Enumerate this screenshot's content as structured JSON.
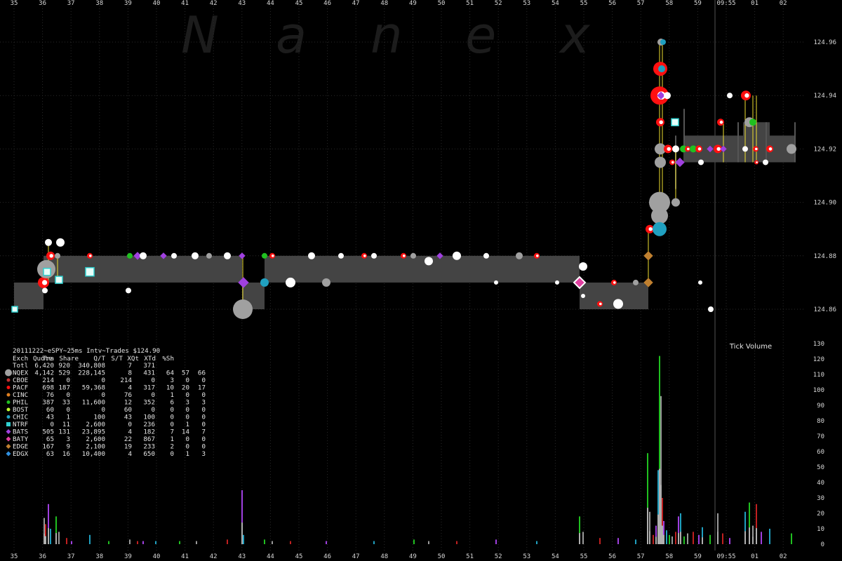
{
  "chart_data": {
    "type": "scatter",
    "watermark": [
      "N",
      "a",
      "n",
      "e",
      "x"
    ],
    "title": "20111222~eSPY~25ms Intv~Trades $124.90",
    "x_ticks": [
      "35",
      "36",
      "37",
      "38",
      "39",
      "40",
      "41",
      "42",
      "43",
      "44",
      "45",
      "46",
      "47",
      "48",
      "49",
      "50",
      "51",
      "52",
      "53",
      "54",
      "55",
      "56",
      "57",
      "58",
      "59",
      "09:55",
      "01",
      "02"
    ],
    "price_axis": {
      "ticks": [
        "124.96",
        "124.94",
        "124.92",
        "124.90",
        "124.88",
        "124.86"
      ],
      "ylim": [
        124.853,
        124.972
      ]
    },
    "volume_axis": {
      "label": "Tick Volume",
      "ticks": [
        "130",
        "120",
        "110",
        "100",
        "90",
        "80",
        "70",
        "60",
        "50",
        "40",
        "30",
        "20",
        "10",
        "0"
      ],
      "ylim": [
        0,
        130
      ]
    },
    "stats_table": {
      "header": [
        "Exch",
        "Quote",
        "Tra",
        "Share",
        "Q/T",
        "S/T",
        "XQt",
        "XTd",
        "%Sh"
      ],
      "rows": [
        {
          "exch": "Totl",
          "quote": "6,420",
          "tra": "920",
          "share": "340,808",
          "qt": "7",
          "st": "371",
          "xqt": "",
          "xtd": "",
          "sh": "",
          "color": "",
          "marker": "none"
        },
        {
          "exch": "NQEX",
          "quote": "4,142",
          "tra": "529",
          "share": "228,145",
          "qt": "8",
          "st": "431",
          "xqt": "64",
          "xtd": "57",
          "sh": "66",
          "color": "#a0a0a0",
          "marker": "bigcircle"
        },
        {
          "exch": "CBOE",
          "quote": "214",
          "tra": "0",
          "share": "0",
          "qt": "214",
          "st": "0",
          "xqt": "3",
          "xtd": "0",
          "sh": "0",
          "color": "#c03030",
          "marker": "circle"
        },
        {
          "exch": "PACF",
          "quote": "698",
          "tra": "187",
          "share": "59,368",
          "qt": "4",
          "st": "317",
          "xqt": "10",
          "xtd": "20",
          "sh": "17",
          "color": "#ff1010",
          "marker": "circle"
        },
        {
          "exch": "CINC",
          "quote": "76",
          "tra": "0",
          "share": "0",
          "qt": "76",
          "st": "0",
          "xqt": "1",
          "xtd": "0",
          "sh": "0",
          "color": "#e08020",
          "marker": "circle"
        },
        {
          "exch": "PHIL",
          "quote": "387",
          "tra": "33",
          "share": "11,600",
          "qt": "12",
          "st": "352",
          "xqt": "6",
          "xtd": "3",
          "sh": "3",
          "color": "#20c020",
          "marker": "circle"
        },
        {
          "exch": "BOST",
          "quote": "60",
          "tra": "0",
          "share": "0",
          "qt": "60",
          "st": "0",
          "xqt": "0",
          "xtd": "0",
          "sh": "0",
          "color": "#c0ff30",
          "marker": "circle"
        },
        {
          "exch": "CHIC",
          "quote": "43",
          "tra": "1",
          "share": "100",
          "qt": "43",
          "st": "100",
          "xqt": "0",
          "xtd": "0",
          "sh": "0",
          "color": "#20a0c0",
          "marker": "circle"
        },
        {
          "exch": "NTRF",
          "quote": "0",
          "tra": "11",
          "share": "2,600",
          "qt": "0",
          "st": "236",
          "xqt": "0",
          "xtd": "1",
          "sh": "0",
          "color": "#30d0d0",
          "marker": "square"
        },
        {
          "exch": "BATS",
          "quote": "505",
          "tra": "131",
          "share": "23,895",
          "qt": "4",
          "st": "182",
          "xqt": "7",
          "xtd": "14",
          "sh": "7",
          "color": "#a040e0",
          "marker": "diamond"
        },
        {
          "exch": "BATY",
          "quote": "65",
          "tra": "3",
          "share": "2,600",
          "qt": "22",
          "st": "867",
          "xqt": "1",
          "xtd": "0",
          "sh": "0",
          "color": "#e040a0",
          "marker": "diamond"
        },
        {
          "exch": "EDGE",
          "quote": "167",
          "tra": "9",
          "share": "2,100",
          "qt": "19",
          "st": "233",
          "xqt": "2",
          "xtd": "0",
          "sh": "0",
          "color": "#c08030",
          "marker": "diamond"
        },
        {
          "exch": "EDGX",
          "quote": "63",
          "tra": "16",
          "share": "10,400",
          "qt": "4",
          "st": "650",
          "xqt": "0",
          "xtd": "1",
          "sh": "3",
          "color": "#3090e0",
          "marker": "diamond"
        }
      ]
    },
    "colors": {
      "background": "#000000",
      "nbbo_band": "#444444",
      "grid": "#2a2a2a",
      "trade_line": "#f0e030",
      "bars": "#9a9a9a"
    },
    "nbbo_band": [
      {
        "t0": 20,
        "t1": 62,
        "bid": 124.86,
        "ask": 124.87
      },
      {
        "t0": 62,
        "t1": 345,
        "bid": 124.87,
        "ask": 124.88
      },
      {
        "t0": 345,
        "t1": 377,
        "bid": 124.86,
        "ask": 124.87
      },
      {
        "t0": 377,
        "t1": 826,
        "bid": 124.87,
        "ask": 124.88
      },
      {
        "t0": 826,
        "t1": 924,
        "bid": 124.86,
        "ask": 124.87
      },
      {
        "t0": 974,
        "t1": 1059,
        "bid": 124.915,
        "ask": 124.925
      },
      {
        "t0": 1059,
        "t1": 1097,
        "bid": 124.915,
        "ask": 124.93
      },
      {
        "t0": 1097,
        "t1": 1133,
        "bid": 124.915,
        "ask": 124.925
      }
    ],
    "trades": [
      {
        "t": 62,
        "p": 124.87,
        "ex": "PACF",
        "size": 8
      },
      {
        "t": 66,
        "p": 124.875,
        "ex": "NQEX",
        "size": 13
      },
      {
        "t": 72,
        "p": 124.88,
        "ex": "PACF",
        "size": 6
      },
      {
        "t": 69,
        "p": 124.885,
        "ex": "WHITE",
        "size": 5
      },
      {
        "t": 86,
        "p": 124.885,
        "ex": "WHITE",
        "size": 6
      },
      {
        "t": 82,
        "p": 124.88,
        "ex": "NQEX",
        "size": 4
      },
      {
        "t": 67,
        "p": 124.874,
        "ex": "NTRF",
        "size": 5
      },
      {
        "t": 84,
        "p": 124.871,
        "ex": "NTRF",
        "size": 5
      },
      {
        "t": 128,
        "p": 124.874,
        "ex": "NTRF",
        "size": 6
      },
      {
        "t": 21,
        "p": 124.86,
        "ex": "NTRF",
        "size": 4
      },
      {
        "t": 64,
        "p": 124.867,
        "ex": "WHITE",
        "size": 4
      },
      {
        "t": 128,
        "p": 124.88,
        "ex": "PACF",
        "size": 4
      },
      {
        "t": 183,
        "p": 124.867,
        "ex": "WHITE",
        "size": 4
      },
      {
        "t": 185,
        "p": 124.88,
        "ex": "PHIL",
        "size": 4
      },
      {
        "t": 196,
        "p": 124.88,
        "ex": "BATS",
        "size": 5
      },
      {
        "t": 204,
        "p": 124.88,
        "ex": "WHITE",
        "size": 5
      },
      {
        "t": 233,
        "p": 124.88,
        "ex": "BATS",
        "size": 4
      },
      {
        "t": 248,
        "p": 124.88,
        "ex": "WHITE",
        "size": 4
      },
      {
        "t": 278,
        "p": 124.88,
        "ex": "WHITE",
        "size": 5
      },
      {
        "t": 298,
        "p": 124.88,
        "ex": "NQEX",
        "size": 4
      },
      {
        "t": 324,
        "p": 124.88,
        "ex": "WHITE",
        "size": 5
      },
      {
        "t": 345,
        "p": 124.88,
        "ex": "BATS",
        "size": 4
      },
      {
        "t": 346,
        "p": 124.86,
        "ex": "NQEX",
        "size": 14
      },
      {
        "t": 347,
        "p": 124.87,
        "ex": "BATS",
        "size": 7
      },
      {
        "t": 377,
        "p": 124.87,
        "ex": "CHIC",
        "size": 6
      },
      {
        "t": 377,
        "p": 124.88,
        "ex": "PHIL",
        "size": 4
      },
      {
        "t": 388,
        "p": 124.88,
        "ex": "PACF",
        "size": 4
      },
      {
        "t": 414,
        "p": 124.87,
        "ex": "WHITE",
        "size": 7
      },
      {
        "t": 444,
        "p": 124.88,
        "ex": "WHITE",
        "size": 5
      },
      {
        "t": 465,
        "p": 124.87,
        "ex": "NQEX",
        "size": 6
      },
      {
        "t": 486,
        "p": 124.88,
        "ex": "WHITE",
        "size": 4
      },
      {
        "t": 519,
        "p": 124.88,
        "ex": "PACF",
        "size": 4
      },
      {
        "t": 533,
        "p": 124.88,
        "ex": "WHITE",
        "size": 4
      },
      {
        "t": 575,
        "p": 124.88,
        "ex": "PACF",
        "size": 4
      },
      {
        "t": 589,
        "p": 124.88,
        "ex": "NQEX",
        "size": 4
      },
      {
        "t": 611,
        "p": 124.878,
        "ex": "WHITE",
        "size": 6
      },
      {
        "t": 627,
        "p": 124.88,
        "ex": "BATS",
        "size": 4
      },
      {
        "t": 651,
        "p": 124.88,
        "ex": "WHITE",
        "size": 6
      },
      {
        "t": 693,
        "p": 124.88,
        "ex": "WHITE",
        "size": 4
      },
      {
        "t": 707,
        "p": 124.87,
        "ex": "WHITE",
        "size": 3
      },
      {
        "t": 740,
        "p": 124.88,
        "ex": "NQEX",
        "size": 5
      },
      {
        "t": 765,
        "p": 124.88,
        "ex": "PACF",
        "size": 4
      },
      {
        "t": 794,
        "p": 124.87,
        "ex": "WHITE",
        "size": 3
      },
      {
        "t": 826,
        "p": 124.87,
        "ex": "BATY",
        "size": 8
      },
      {
        "t": 831,
        "p": 124.876,
        "ex": "WHITE",
        "size": 6
      },
      {
        "t": 831,
        "p": 124.865,
        "ex": "WHITE",
        "size": 3
      },
      {
        "t": 855,
        "p": 124.862,
        "ex": "PACF",
        "size": 4
      },
      {
        "t": 875,
        "p": 124.87,
        "ex": "PACF",
        "size": 4
      },
      {
        "t": 881,
        "p": 124.862,
        "ex": "WHITE",
        "size": 7
      },
      {
        "t": 906,
        "p": 124.87,
        "ex": "NQEX",
        "size": 4
      },
      {
        "t": 924,
        "p": 124.87,
        "ex": "EDGE",
        "size": 6
      },
      {
        "t": 924,
        "p": 124.88,
        "ex": "EDGE",
        "size": 6
      },
      {
        "t": 926,
        "p": 124.89,
        "ex": "PACF",
        "size": 6
      },
      {
        "t": 940,
        "p": 124.9,
        "ex": "NQEX",
        "size": 15
      },
      {
        "t": 940,
        "p": 124.895,
        "ex": "NQEX",
        "size": 12
      },
      {
        "t": 940,
        "p": 124.89,
        "ex": "CHIC",
        "size": 10
      },
      {
        "t": 941,
        "p": 124.915,
        "ex": "NQEX",
        "size": 8
      },
      {
        "t": 940,
        "p": 124.94,
        "ex": "PACF",
        "size": 13
      },
      {
        "t": 941,
        "p": 124.95,
        "ex": "PACF",
        "size": 10
      },
      {
        "t": 942,
        "p": 124.96,
        "ex": "NQEX",
        "size": 5
      },
      {
        "t": 945,
        "p": 124.96,
        "ex": "CHIC",
        "size": 4
      },
      {
        "t": 943,
        "p": 124.95,
        "ex": "CHIC",
        "size": 5
      },
      {
        "t": 942,
        "p": 124.94,
        "ex": "BATS",
        "size": 5
      },
      {
        "t": 951,
        "p": 124.94,
        "ex": "WHITE",
        "size": 5
      },
      {
        "t": 941,
        "p": 124.93,
        "ex": "PACF",
        "size": 6
      },
      {
        "t": 962,
        "p": 124.93,
        "ex": "NTRF",
        "size": 5
      },
      {
        "t": 941,
        "p": 124.92,
        "ex": "NQEX",
        "size": 8
      },
      {
        "t": 952,
        "p": 124.92,
        "ex": "PACF",
        "size": 6
      },
      {
        "t": 963,
        "p": 124.92,
        "ex": "WHITE",
        "size": 5
      },
      {
        "t": 974,
        "p": 124.92,
        "ex": "PHIL",
        "size": 5
      },
      {
        "t": 980,
        "p": 124.92,
        "ex": "PACF",
        "size": 4
      },
      {
        "t": 988,
        "p": 124.92,
        "ex": "PHIL",
        "size": 5
      },
      {
        "t": 996,
        "p": 124.92,
        "ex": "PACF",
        "size": 5
      },
      {
        "t": 1012,
        "p": 124.92,
        "ex": "BATS",
        "size": 4
      },
      {
        "t": 1023,
        "p": 124.92,
        "ex": "PACF",
        "size": 6
      },
      {
        "t": 1031,
        "p": 124.92,
        "ex": "BATS",
        "size": 4
      },
      {
        "t": 1062,
        "p": 124.92,
        "ex": "WHITE",
        "size": 4
      },
      {
        "t": 1077,
        "p": 124.92,
        "ex": "PACF",
        "size": 4
      },
      {
        "t": 1097,
        "p": 124.92,
        "ex": "PACF",
        "size": 5
      },
      {
        "t": 1128,
        "p": 124.92,
        "ex": "NQEX",
        "size": 7
      },
      {
        "t": 963,
        "p": 124.9,
        "ex": "NQEX",
        "size": 6
      },
      {
        "t": 969,
        "p": 124.915,
        "ex": "BATS",
        "size": 6
      },
      {
        "t": 958,
        "p": 124.915,
        "ex": "PACF",
        "size": 4
      },
      {
        "t": 999,
        "p": 124.915,
        "ex": "WHITE",
        "size": 4
      },
      {
        "t": 1027,
        "p": 124.93,
        "ex": "PACF",
        "size": 5
      },
      {
        "t": 1040,
        "p": 124.94,
        "ex": "WHITE",
        "size": 4
      },
      {
        "t": 1063,
        "p": 124.94,
        "ex": "PACF",
        "size": 7
      },
      {
        "t": 1068,
        "p": 124.93,
        "ex": "NQEX",
        "size": 7
      },
      {
        "t": 1073,
        "p": 124.93,
        "ex": "PHIL",
        "size": 5
      },
      {
        "t": 1078,
        "p": 124.915,
        "ex": "PACF",
        "size": 3
      },
      {
        "t": 1091,
        "p": 124.915,
        "ex": "WHITE",
        "size": 4
      },
      {
        "t": 1013,
        "p": 124.86,
        "ex": "WHITE",
        "size": 4
      },
      {
        "t": 998,
        "p": 124.87,
        "ex": "WHITE",
        "size": 3
      }
    ],
    "volume_bars": [
      {
        "t": 63,
        "v": 17
      },
      {
        "t": 65,
        "v": 13
      },
      {
        "t": 69,
        "v": 26
      },
      {
        "t": 72,
        "v": 10
      },
      {
        "t": 80,
        "v": 18
      },
      {
        "t": 84,
        "v": 8
      },
      {
        "t": 95,
        "v": 4
      },
      {
        "t": 102,
        "v": 2
      },
      {
        "t": 128,
        "v": 6
      },
      {
        "t": 155,
        "v": 2
      },
      {
        "t": 185,
        "v": 3
      },
      {
        "t": 196,
        "v": 2
      },
      {
        "t": 204,
        "v": 2
      },
      {
        "t": 222,
        "v": 2
      },
      {
        "t": 256,
        "v": 2
      },
      {
        "t": 280,
        "v": 2
      },
      {
        "t": 324,
        "v": 3
      },
      {
        "t": 345,
        "v": 35
      },
      {
        "t": 347,
        "v": 6
      },
      {
        "t": 377,
        "v": 3
      },
      {
        "t": 388,
        "v": 2
      },
      {
        "t": 414,
        "v": 2
      },
      {
        "t": 465,
        "v": 2
      },
      {
        "t": 533,
        "v": 2
      },
      {
        "t": 590,
        "v": 3
      },
      {
        "t": 611,
        "v": 2
      },
      {
        "t": 651,
        "v": 2
      },
      {
        "t": 707,
        "v": 3
      },
      {
        "t": 765,
        "v": 2
      },
      {
        "t": 826,
        "v": 18
      },
      {
        "t": 831,
        "v": 8
      },
      {
        "t": 855,
        "v": 4
      },
      {
        "t": 881,
        "v": 4
      },
      {
        "t": 906,
        "v": 3
      },
      {
        "t": 923,
        "v": 59
      },
      {
        "t": 926,
        "v": 21
      },
      {
        "t": 931,
        "v": 6
      },
      {
        "t": 935,
        "v": 12
      },
      {
        "t": 938,
        "v": 48
      },
      {
        "t": 940,
        "v": 122
      },
      {
        "t": 942,
        "v": 96
      },
      {
        "t": 944,
        "v": 30
      },
      {
        "t": 946,
        "v": 15
      },
      {
        "t": 950,
        "v": 9
      },
      {
        "t": 954,
        "v": 6
      },
      {
        "t": 958,
        "v": 5
      },
      {
        "t": 963,
        "v": 8
      },
      {
        "t": 967,
        "v": 18
      },
      {
        "t": 970,
        "v": 20
      },
      {
        "t": 975,
        "v": 5
      },
      {
        "t": 980,
        "v": 7
      },
      {
        "t": 988,
        "v": 8
      },
      {
        "t": 996,
        "v": 6
      },
      {
        "t": 1001,
        "v": 11
      },
      {
        "t": 1012,
        "v": 6
      },
      {
        "t": 1023,
        "v": 20
      },
      {
        "t": 1030,
        "v": 7
      },
      {
        "t": 1040,
        "v": 4
      },
      {
        "t": 1062,
        "v": 21
      },
      {
        "t": 1068,
        "v": 27
      },
      {
        "t": 1073,
        "v": 12
      },
      {
        "t": 1078,
        "v": 26
      },
      {
        "t": 1085,
        "v": 8
      },
      {
        "t": 1097,
        "v": 10
      },
      {
        "t": 1128,
        "v": 7
      }
    ]
  }
}
